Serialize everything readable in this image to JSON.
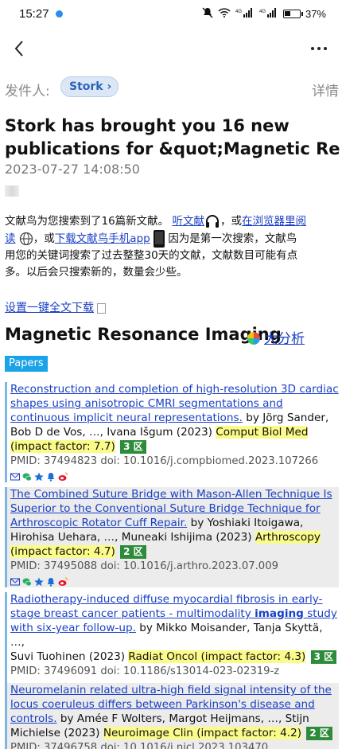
{
  "status_bar": {
    "time": "15:27",
    "signal_label_1": "4G",
    "signal_label_2": "4G",
    "battery": "37%"
  },
  "nav": {
    "back_icon": "chevron-left-icon",
    "more_icon": "more-horizontal-icon"
  },
  "header": {
    "sender_label": "发件人:",
    "sender_name": "Stork",
    "detail_label": "详情",
    "subject": "Stork has brought you 16 new publications for &quot;Magnetic Re",
    "date": "2023-07-27 14:08:50"
  },
  "intro": {
    "text1": "文献鸟为您搜索到了16篇新文献。",
    "listen_link": "听文献",
    "text2": "，或",
    "browser_link_a": "在浏览器里阅",
    "browser_link_b": "读",
    "text3": "，或",
    "download_link": "下载文献鸟手机app",
    "text4": "因为是第一次搜索，文献鸟",
    "text5": "用您的关键词搜索了过去整整30天的文献，文献数目可能有点",
    "text6": "多。以后会只搜索新的，数量会少些。"
  },
  "setup_link": "设置一键全文下载",
  "section": {
    "title": "Magnetic Resonance Imaging",
    "analysis_link": "大分析",
    "tag": "Papers"
  },
  "papers": [
    {
      "title_lines": [
        "Reconstruction and completion of high-resolution 3D cardiac",
        "shapes using anisotropic CMRI segmentations and",
        "continuous implicit neural representations."
      ],
      "authors_a": " by Jörg Sander,",
      "authors_b": "Bob D de Vos, …, Ivana Išgum (2023) ",
      "journal": "Comput Biol Med",
      "impact": "(impact factor: 7.7)",
      "zone": "3 区",
      "pmid": "PMID: 37494823 doi: 10.1016/j.compbiomed.2023.107266"
    },
    {
      "title_lines": [
        "The Combined Suture Bridge with Mason-Allen Technique Is",
        "Superior to the Conventional Suture Bridge Technique for",
        "Arthroscopic Rotator Cuff Repair."
      ],
      "authors_a": " by Yoshiaki Itoigawa,",
      "authors_b": "Hirohisa Uehara, …, Muneaki Ishijima (2023) ",
      "journal": "Arthroscopy",
      "impact": "(impact factor: 4.7)",
      "zone": "2 区",
      "pmid": "PMID: 37495088 doi: 10.1016/j.arthro.2023.07.009"
    },
    {
      "title_lines": [
        "Radiotherapy-induced diffuse myocardial fibrosis in early-",
        "stage breast cancer patients - multimodality ",
        "imaging",
        " study",
        "with six-year follow-up."
      ],
      "authors_a": " by Mikko Moisander, Tanja Skyttä, …,",
      "authors_b": "Suvi Tuohinen (2023) ",
      "journal": "Radiat Oncol (impact factor: 4.3)",
      "zone": "3 区",
      "pmid": "PMID: 37496091 doi: 10.1186/s13014-023-02319-z"
    },
    {
      "title_lines": [
        "Neuromelanin related ultra-high field signal intensity of the",
        "locus coeruleus differs between Parkinson's disease and",
        "controls."
      ],
      "authors_a": " by Amée F Wolters, Margot Heijmans, …, Stijn",
      "authors_b": "Michielse (2023) ",
      "journal": "Neuroimage Clin (impact factor: 4.2)",
      "zone": "2 区",
      "pmid": "PMID: 37496758 doi: 10.1016/j.nicl.2023.103470"
    }
  ],
  "action_icons": [
    "mail-icon",
    "wechat-icon",
    "star-icon",
    "bell-icon",
    "weibo-icon"
  ],
  "colors": {
    "link": "#1a3fc4",
    "highlight": "#fbfb8a",
    "zone_badge": "#2e8b3a",
    "tag": "#1aa3e8"
  }
}
